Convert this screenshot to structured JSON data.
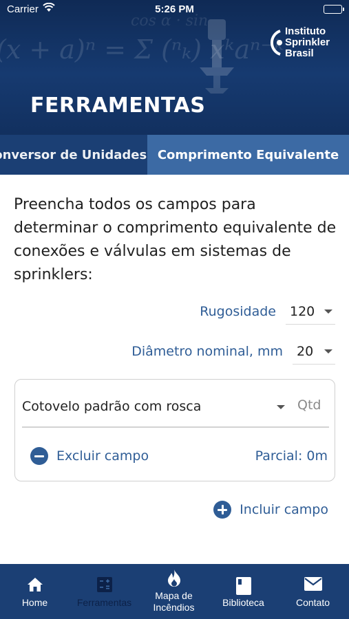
{
  "status_bar": {
    "carrier": "Carrier",
    "time": "5:26 PM"
  },
  "header": {
    "title": "FERRAMENTAS",
    "logo_lines": [
      "Instituto",
      "Sprinkler",
      "Brasil"
    ]
  },
  "tabs": [
    {
      "label": "Conversor de Unidades",
      "active": false
    },
    {
      "label": "Comprimento Equivalente",
      "active": true
    }
  ],
  "intro_text": "Preencha todos os campos para determinar o comprimento equivalente de conexões e válvulas em sistemas de sprinklers:",
  "fields": {
    "roughness": {
      "label": "Rugosidade",
      "value": "120"
    },
    "diameter": {
      "label": "Diâmetro nominal, mm",
      "value": "20"
    }
  },
  "fitting_card": {
    "fitting_value": "Cotovelo padrão com rosca",
    "qty_placeholder": "Qtd",
    "remove_label": "Excluir campo",
    "partial_label": "Parcial: 0m"
  },
  "add_field_label": "Incluir campo",
  "bottom_nav": [
    {
      "label": "Home",
      "icon": "home-icon",
      "active": false
    },
    {
      "label": "Ferramentas",
      "icon": "calculator-icon",
      "active": true
    },
    {
      "label": "Mapa de Incêndios",
      "icon": "fire-icon",
      "active": false
    },
    {
      "label": "Biblioteca",
      "icon": "book-icon",
      "active": false
    },
    {
      "label": "Contato",
      "icon": "envelope-icon",
      "active": false
    }
  ],
  "colors": {
    "primary_dark": "#1b3f74",
    "active_tab": "#3c6aa4",
    "accent_text": "#2f5d96"
  }
}
